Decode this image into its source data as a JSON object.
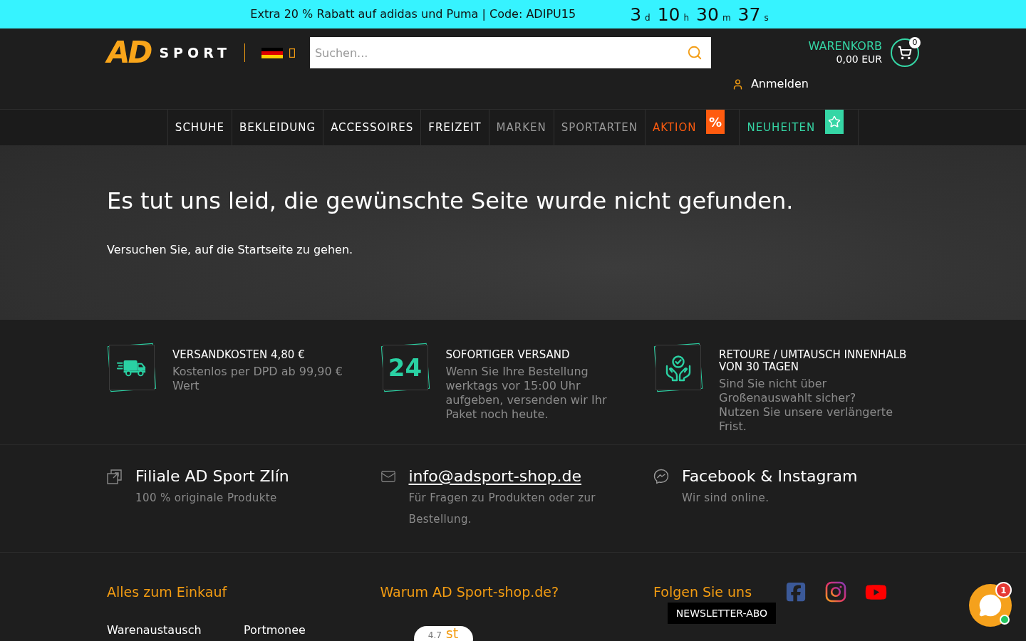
{
  "promo_bar": {
    "text": "Extra 20 % Rabatt auf adidas und Puma | Code: ADIPU15",
    "countdown": [
      {
        "value": "3",
        "unit": "d"
      },
      {
        "value": "10",
        "unit": "h"
      },
      {
        "value": "30",
        "unit": "m"
      },
      {
        "value": "37",
        "unit": "s"
      }
    ]
  },
  "header": {
    "logo": {
      "mark": "AD",
      "text": "SPORT"
    },
    "search": {
      "placeholder": "Suchen..."
    },
    "cart": {
      "label": "WARENKORB",
      "total": "0,00 EUR",
      "count": "0"
    },
    "login": "Anmelden"
  },
  "nav": [
    {
      "label": "SCHUHE",
      "kind": "main"
    },
    {
      "label": "BEKLEIDUNG",
      "kind": "main"
    },
    {
      "label": "ACCESSOIRES",
      "kind": "main"
    },
    {
      "label": "FREIZEIT",
      "kind": "main"
    },
    {
      "label": "MARKEN",
      "kind": "muted"
    },
    {
      "label": "SPORTARTEN",
      "kind": "muted"
    },
    {
      "label": "AKTION",
      "kind": "sale",
      "badge": "%"
    },
    {
      "label": "NEUHEITEN",
      "kind": "new"
    }
  ],
  "hero": {
    "title": "Es tut uns leid, die gewünschte Seite wurde nicht gefunden.",
    "text": "Versuchen Sie, auf die Startseite zu gehen."
  },
  "features": [
    {
      "kind": "icon",
      "title": "VERSANDKOSTEN 4,80 €",
      "text": "Kostenlos per DPD ab 99,90 € Wert"
    },
    {
      "kind": "number",
      "number": "24",
      "title": "SOFORTIGER VERSAND",
      "text": "Wenn Sie Ihre Bestellung werktags vor 15:00 Uhr aufgeben, versenden wir Ihr Paket noch heute."
    },
    {
      "kind": "icon",
      "title": "RETOURE / UMTAUSCH INNENHALB VON 30 TAGEN",
      "text": "Sind Sie nicht über Großenauswahlt sicher?\nNutzen Sie unsere verlängerte Frist."
    }
  ],
  "contacts": [
    {
      "kind": "text",
      "title": "Filiale AD Sport Zlín",
      "text": "100 % originale Produkte"
    },
    {
      "kind": "link",
      "title": "info@adsport-shop.de",
      "text": "Für Fragen zu Produkten oder zur Bestellung."
    },
    {
      "kind": "text",
      "title": "Facebook & Instagram",
      "text": "Wir sind online."
    }
  ],
  "footer": {
    "shopping": {
      "heading": "Alles zum Einkauf",
      "links": [
        "Warenaustausch",
        "Portmonee"
      ]
    },
    "about": {
      "heading": "Warum AD Sport-shop.de?",
      "rating": {
        "score": "4.7",
        "suffix": "st"
      }
    },
    "social": {
      "heading": "Folgen Sie uns"
    },
    "newsletter_tooltip": "NEWSLETTER-ABO"
  },
  "chat": {
    "badge": "1",
    "online": true
  }
}
